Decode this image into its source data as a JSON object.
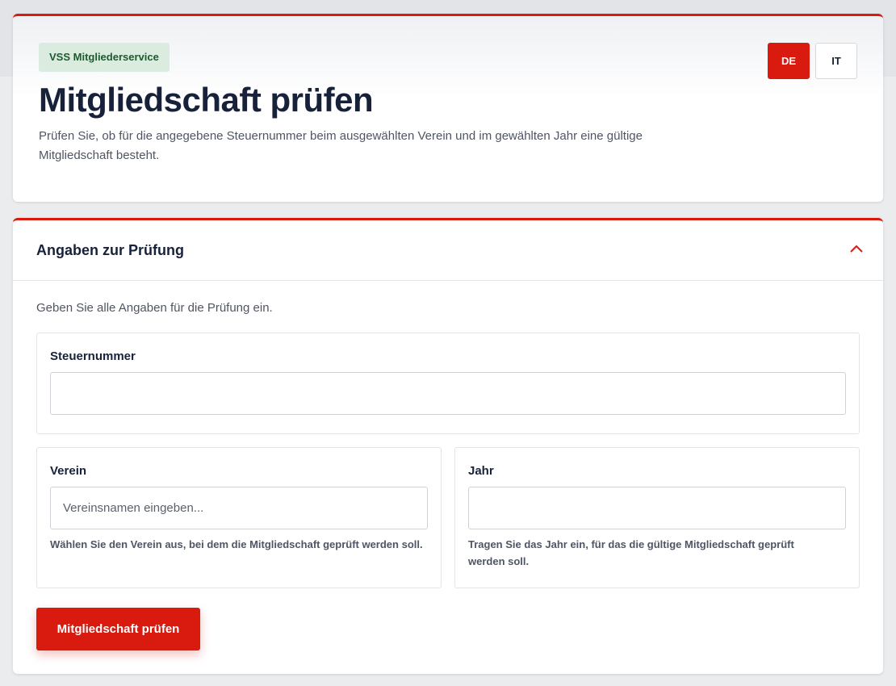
{
  "header": {
    "badge": "VSS Mitgliederservice",
    "title": "Mitgliedschaft prüfen",
    "description": "Prüfen Sie, ob für die angegebene Steuernummer beim ausgewählten Verein und im gewählten Jahr eine gültige Mitgliedschaft besteht.",
    "languages": [
      {
        "code": "DE",
        "active": true
      },
      {
        "code": "IT",
        "active": false
      }
    ]
  },
  "form": {
    "section_title": "Angaben zur Prüfung",
    "toggle_icon": "chevron-up-icon",
    "intro": "Geben Sie alle Angaben für die Prüfung ein.",
    "tax_number": {
      "label": "Steuernummer",
      "value": ""
    },
    "club": {
      "label": "Verein",
      "value": "",
      "placeholder": "Vereinsnamen eingeben...",
      "hint": "Wählen Sie den Verein aus, bei dem die Mitgliedschaft geprüft werden soll."
    },
    "year": {
      "label": "Jahr",
      "value": "",
      "hint": "Tragen Sie das Jahr ein, für das die gültige Mitgliedschaft geprüft werden soll."
    },
    "submit_label": "Mitgliedschaft prüfen"
  },
  "colors": {
    "accent": "#d81a0f",
    "badge_bg": "#dcebe0",
    "badge_text": "#1d5a2c",
    "heading": "#17223a"
  }
}
